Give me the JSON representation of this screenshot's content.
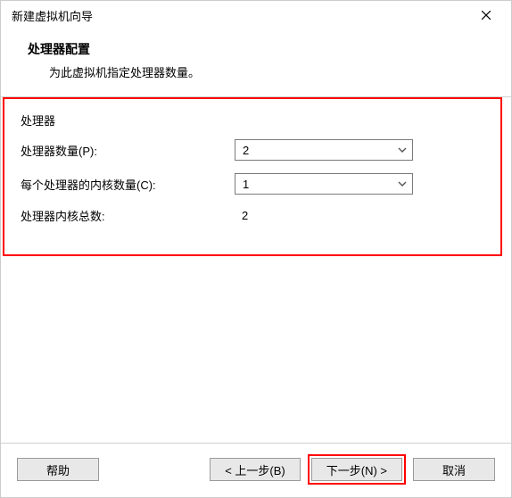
{
  "titlebar": {
    "title": "新建虚拟机向导"
  },
  "header": {
    "title": "处理器配置",
    "desc": "为此虚拟机指定处理器数量。"
  },
  "group": {
    "label": "处理器",
    "rows": {
      "proc_count_label": "处理器数量(P):",
      "proc_count_value": "2",
      "cores_per_label": "每个处理器的内核数量(C):",
      "cores_per_value": "1",
      "total_label": "处理器内核总数:",
      "total_value": "2"
    }
  },
  "footer": {
    "help": "帮助",
    "back": "< 上一步(B)",
    "next": "下一步(N) >",
    "cancel": "取消"
  }
}
